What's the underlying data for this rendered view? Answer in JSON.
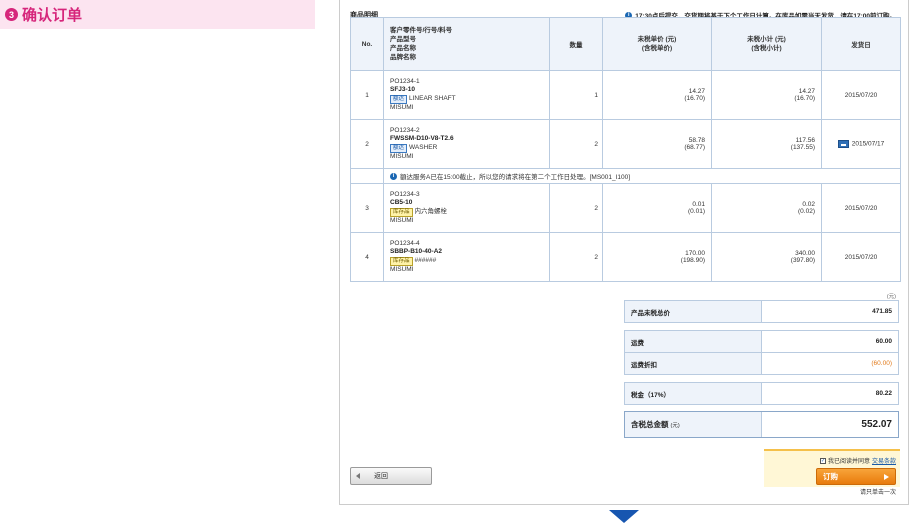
{
  "step": {
    "number": "3",
    "title": "确认订单"
  },
  "section_title": "商品明细",
  "top_notice": "17:30点后提交，交货期将基于下个工作日计算。在库品如需当天发货，请在17:00前订购。",
  "table": {
    "headers": {
      "no": "No.",
      "product": [
        "客户零件号/行号/料号",
        "产品型号",
        "产品名称",
        "品牌名称"
      ],
      "quantity": "数量",
      "unit_price": [
        "未税单价 (元)",
        "(含税单价)"
      ],
      "subtotal": [
        "未税小计 (元)",
        "(含税小计)"
      ],
      "ship_date": "发货日"
    },
    "rows": [
      {
        "no": "1",
        "po": "PO1234-1",
        "part": "SFJ3-10",
        "tag": "额达",
        "name": "LINEAR SHAFT",
        "brand": "MISUMI",
        "qty": "1",
        "unit_price": "14.27",
        "unit_price_tax": "(16.70)",
        "subtotal": "14.27",
        "subtotal_tax": "(16.70)",
        "ship_date": "2015/07/20"
      },
      {
        "no": "2",
        "po": "PO1234-2",
        "part": "FWSSM-D10-V8-T2.6",
        "tag": "额达",
        "name": "WASHER",
        "brand": "MISUMI",
        "qty": "2",
        "unit_price": "58.78",
        "unit_price_tax": "(68.77)",
        "subtotal": "117.56",
        "subtotal_tax": "(137.55)",
        "ship_date": "2015/07/17"
      },
      {
        "no": "3",
        "po": "PO1234-3",
        "part": "CB5-10",
        "tag": "库存品",
        "name": "内六角螺栓",
        "brand": "MISUMI",
        "qty": "2",
        "unit_price": "0.01",
        "unit_price_tax": "(0.01)",
        "subtotal": "0.02",
        "subtotal_tax": "(0.02)",
        "ship_date": "2015/07/20"
      },
      {
        "no": "4",
        "po": "PO1234-4",
        "part": "SBBP-B10-40-A2",
        "tag": "库存品",
        "name": "######",
        "brand": "MISUMI",
        "qty": "2",
        "unit_price": "170.00",
        "unit_price_tax": "(198.90)",
        "subtotal": "340.00",
        "subtotal_tax": "(397.80)",
        "ship_date": "2015/07/20"
      }
    ],
    "row2_notice": "額达服务A已在15:00截止，所以您的请求将在第二个工作日处理。[MS001_I100]"
  },
  "unit_note": "(元)",
  "summary": {
    "product_total_label": "产品未税总价",
    "product_total_value": "471.85",
    "shipping_label": "运费",
    "shipping_value": "60.00",
    "shipping_discount_label": "运费折扣",
    "shipping_discount_value": "(60.00)",
    "tax_label": "税金（17%）",
    "tax_value": "80.22",
    "grand_total_label": "含税总金额",
    "grand_total_unit": "(元)",
    "grand_total_value": "552.07"
  },
  "back_button": "返回",
  "agree": {
    "text": "我已阅读并同意",
    "link": "交易条款"
  },
  "order_button": "订购",
  "click_once": "请只单击一次",
  "colors": {
    "accent_pink": "#d6267b",
    "order_orange": "#f39221",
    "link_blue": "#1a5aa8",
    "arrow_blue": "#1756b0"
  }
}
